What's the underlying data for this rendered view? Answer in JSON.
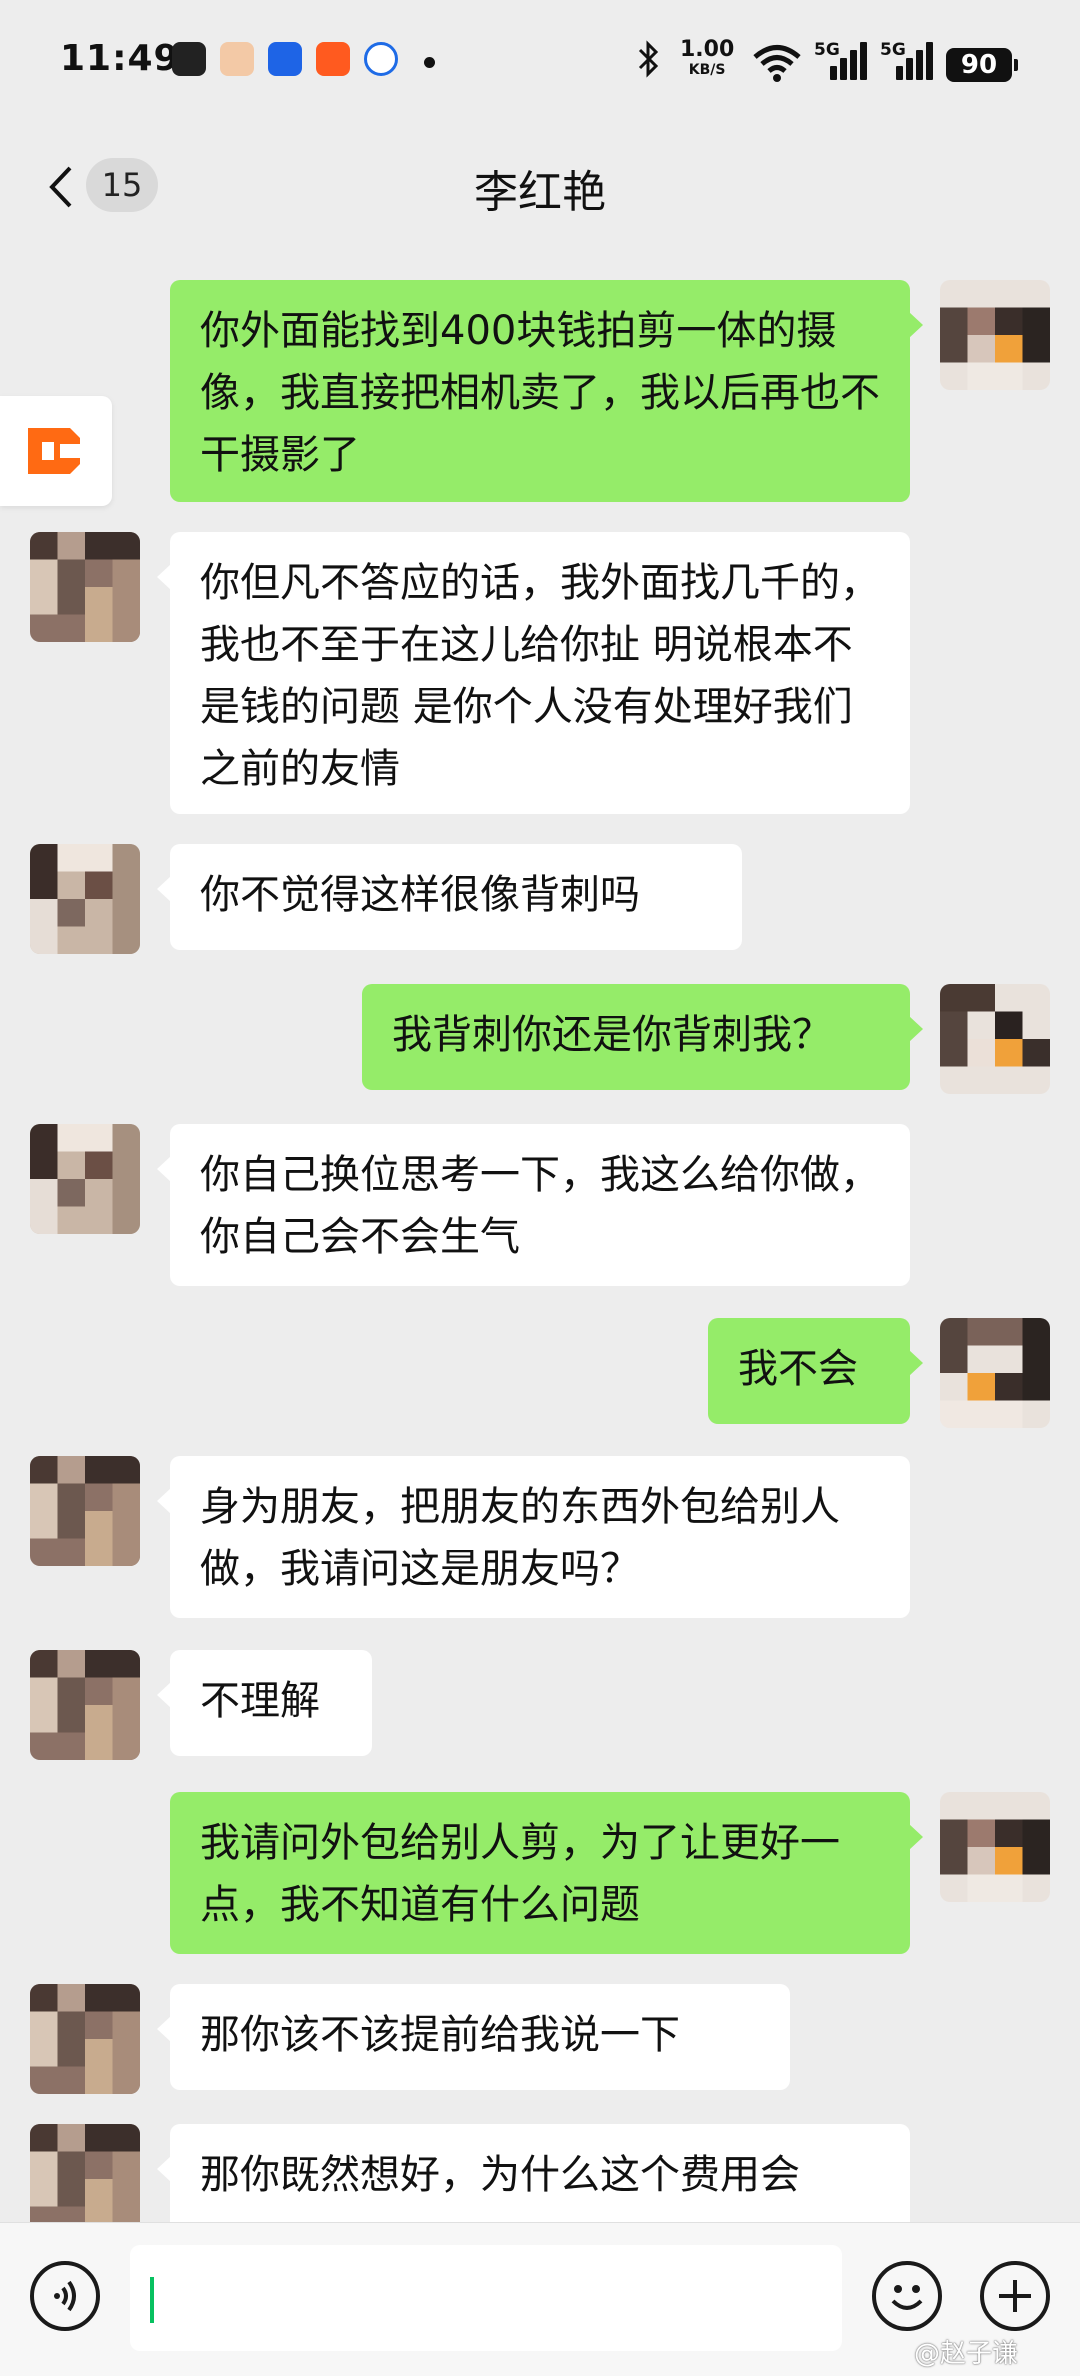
{
  "status_bar": {
    "time": "11:49",
    "net_speed_value": "1.00",
    "net_speed_unit": "KB/S",
    "signal1_label": "5G",
    "signal2_label": "5G",
    "battery": "90"
  },
  "header": {
    "back_count": "15",
    "title": "李红艳"
  },
  "messages": [
    {
      "side": "right",
      "text": "你外面能找到400块钱拍剪一体的摄像，我直接把相机卖了，我以后再也不干摄影了"
    },
    {
      "side": "left",
      "text": "你但凡不答应的话，我外面找几千的，我也不至于在这儿给你扯 明说根本不是钱的问题 是你个人没有处理好我们之前的友情"
    },
    {
      "side": "left",
      "text": "你不觉得这样很像背刺吗"
    },
    {
      "side": "right",
      "text": "我背刺你还是你背刺我？"
    },
    {
      "side": "left",
      "text": "你自己换位思考一下，我这么给你做，你自己会不会生气"
    },
    {
      "side": "right",
      "text": "我不会"
    },
    {
      "side": "left",
      "text": "身为朋友，把朋友的东西外包给别人做，我请问这是朋友吗？"
    },
    {
      "side": "left",
      "text": "不理解"
    },
    {
      "side": "right",
      "text": "我请问外包给别人剪，为了让更好一点，我不知道有什么问题"
    },
    {
      "side": "left",
      "text": "那你该不该提前给我说一下"
    },
    {
      "side": "left",
      "text": "那你既然想好，为什么这个费用会"
    }
  ],
  "colors": {
    "background": "#ededed",
    "bubble_self": "#95ec69",
    "bubble_other": "#ffffff",
    "accent": "#07c160"
  },
  "input_bar": {
    "voice_icon": "voice-icon",
    "emoji_icon": "emoji-icon",
    "add_icon": "plus-icon"
  },
  "watermark": "@赵子谦"
}
